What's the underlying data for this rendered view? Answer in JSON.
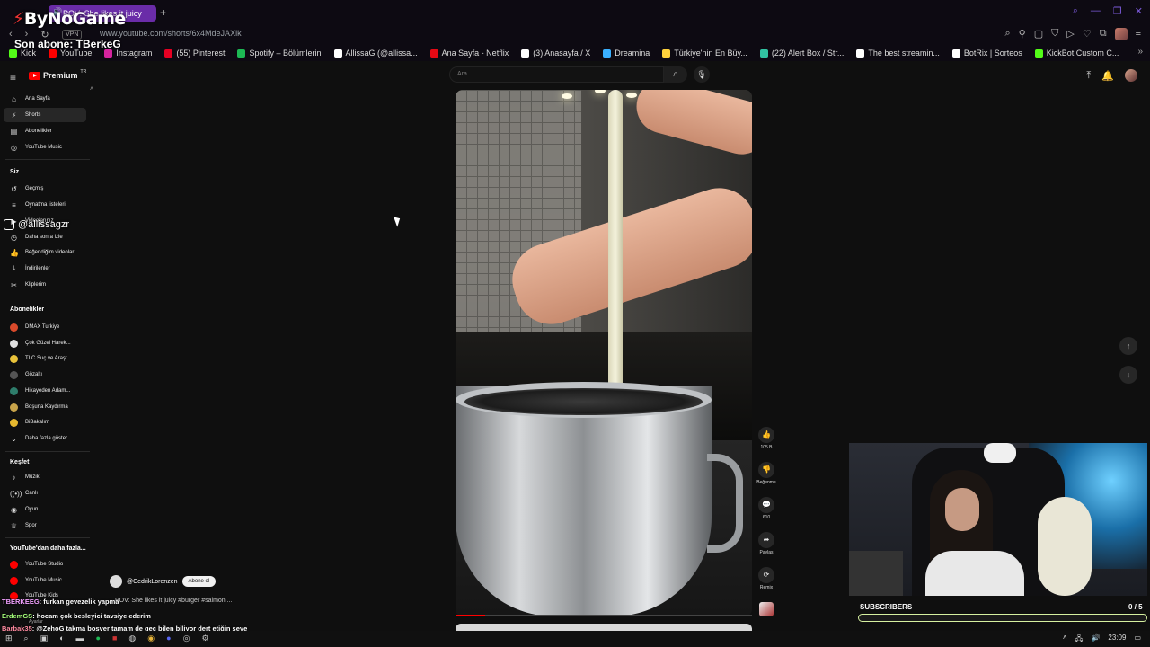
{
  "browser": {
    "active_tab_title": "POV: She likes it juicy",
    "url": "www.youtube.com/shorts/6x4MdeJAXlk",
    "vpn_label": "VPN"
  },
  "overlay": {
    "logo": "ByNoGame",
    "last_sub": "Son abone: TBerkeG",
    "social_handle": "@allissagzr"
  },
  "bookmarks": [
    {
      "label": "Kick",
      "color": "#53fc18"
    },
    {
      "label": "YouTube",
      "color": "#ff0000"
    },
    {
      "label": "Instagram",
      "color": "#d6249f"
    },
    {
      "label": "(55) Pinterest",
      "color": "#e60023"
    },
    {
      "label": "Spotify – Bölümlerin",
      "color": "#1db954"
    },
    {
      "label": "AllissaG (@allissa...",
      "color": "#ffffff"
    },
    {
      "label": "Ana Sayfa - Netflix",
      "color": "#e50914"
    },
    {
      "label": "(3) Anasayfa / X",
      "color": "#ffffff"
    },
    {
      "label": "Dreamina",
      "color": "#3ab0ff"
    },
    {
      "label": "Türkiye'nin En Büy...",
      "color": "#ffd23c"
    },
    {
      "label": "(22) Alert Box / Str...",
      "color": "#31c3a2"
    },
    {
      "label": "The best streamin...",
      "color": "#ffffff"
    },
    {
      "label": "BotRix | Sorteos",
      "color": "#ffffff"
    },
    {
      "label": "KickBot Custom C...",
      "color": "#53fc18"
    }
  ],
  "youtube": {
    "brand": "Premium",
    "brand_tm": "TR",
    "search_placeholder": "Ara"
  },
  "sidebar": {
    "main": [
      {
        "label": "Ana Sayfa",
        "icon": "home-icon",
        "glyph": "⌂"
      },
      {
        "label": "Shorts",
        "icon": "shorts-icon",
        "glyph": "⚡"
      },
      {
        "label": "Abonelikler",
        "icon": "subscriptions-icon",
        "glyph": "▤"
      },
      {
        "label": "YouTube Music",
        "icon": "music-icon",
        "glyph": "◎"
      }
    ],
    "you_heading": "Siz",
    "you": [
      {
        "label": "Geçmiş",
        "icon": "history-icon",
        "glyph": "↺"
      },
      {
        "label": "Oynatma listeleri",
        "icon": "playlist-icon",
        "glyph": "≡"
      },
      {
        "label": "Videolarınız",
        "icon": "your-videos-icon",
        "glyph": "▶"
      },
      {
        "label": "Daha sonra izle",
        "icon": "watch-later-icon",
        "glyph": "◷"
      },
      {
        "label": "Beğendiğim videolar",
        "icon": "like-icon",
        "glyph": "👍"
      },
      {
        "label": "İndirilenler",
        "icon": "download-icon",
        "glyph": "⤓"
      },
      {
        "label": "Kliplerim",
        "icon": "clip-icon",
        "glyph": "✂"
      }
    ],
    "subs_heading": "Abonelikler",
    "subs": [
      {
        "label": "DMAX Turkiye",
        "color": "#d94a2b"
      },
      {
        "label": "Çok Güzel Harek...",
        "color": "#e0e0e0"
      },
      {
        "label": "TLC Suç ve Araşt...",
        "color": "#e8c23a"
      },
      {
        "label": "Gözaltı",
        "color": "#555"
      },
      {
        "label": "Hikayeden Adam...",
        "color": "#2e7d6b"
      },
      {
        "label": "Boşuna Kaydırma",
        "color": "#c7a34a"
      },
      {
        "label": "BiBakalım",
        "color": "#e6b82f"
      }
    ],
    "show_more": "Daha fazla göster",
    "explore_heading": "Keşfet",
    "explore": [
      {
        "label": "Müzik",
        "icon": "music-note-icon",
        "glyph": "♪"
      },
      {
        "label": "Canlı",
        "icon": "live-icon",
        "glyph": "((•))"
      },
      {
        "label": "Oyun",
        "icon": "gaming-icon",
        "glyph": "◉"
      },
      {
        "label": "Spor",
        "icon": "trophy-icon",
        "glyph": "♕"
      }
    ],
    "more_heading": "YouTube'dan daha fazla...",
    "more": [
      {
        "label": "YouTube Studio",
        "color": "#ff0000"
      },
      {
        "label": "YouTube Music",
        "color": "#ff0000"
      },
      {
        "label": "YouTube Kids",
        "color": "#ff0000"
      }
    ],
    "settings": "Ayarlar"
  },
  "shorts": {
    "likes": "105 B",
    "dislike_label": "Beğenme",
    "comments": "610",
    "share_label": "Paylaş",
    "remix_label": "Remix",
    "channel": "@CedrikLorenzen",
    "subscribe": "Abone ol",
    "title": "POV: She likes it juicy #burger #salmon ...",
    "progress": 0.1
  },
  "chat": [
    {
      "user": "TBERKEEG",
      "msg": ": furkan gevezelik yapma"
    },
    {
      "user": "ErdemGS",
      "msg": ": hocam çok besleyici tavsiye ederim"
    },
    {
      "user": "Barbak35",
      "msg": ": @ZehoG takma boşver tamam de geç bilen biliyor dert etiğin şeye"
    }
  ],
  "webcam": {
    "goal_label": "SUBSCRIBERS",
    "goal_count": "0 / 5",
    "goal_progress": 0
  },
  "taskbar": {
    "time": "23:09"
  }
}
